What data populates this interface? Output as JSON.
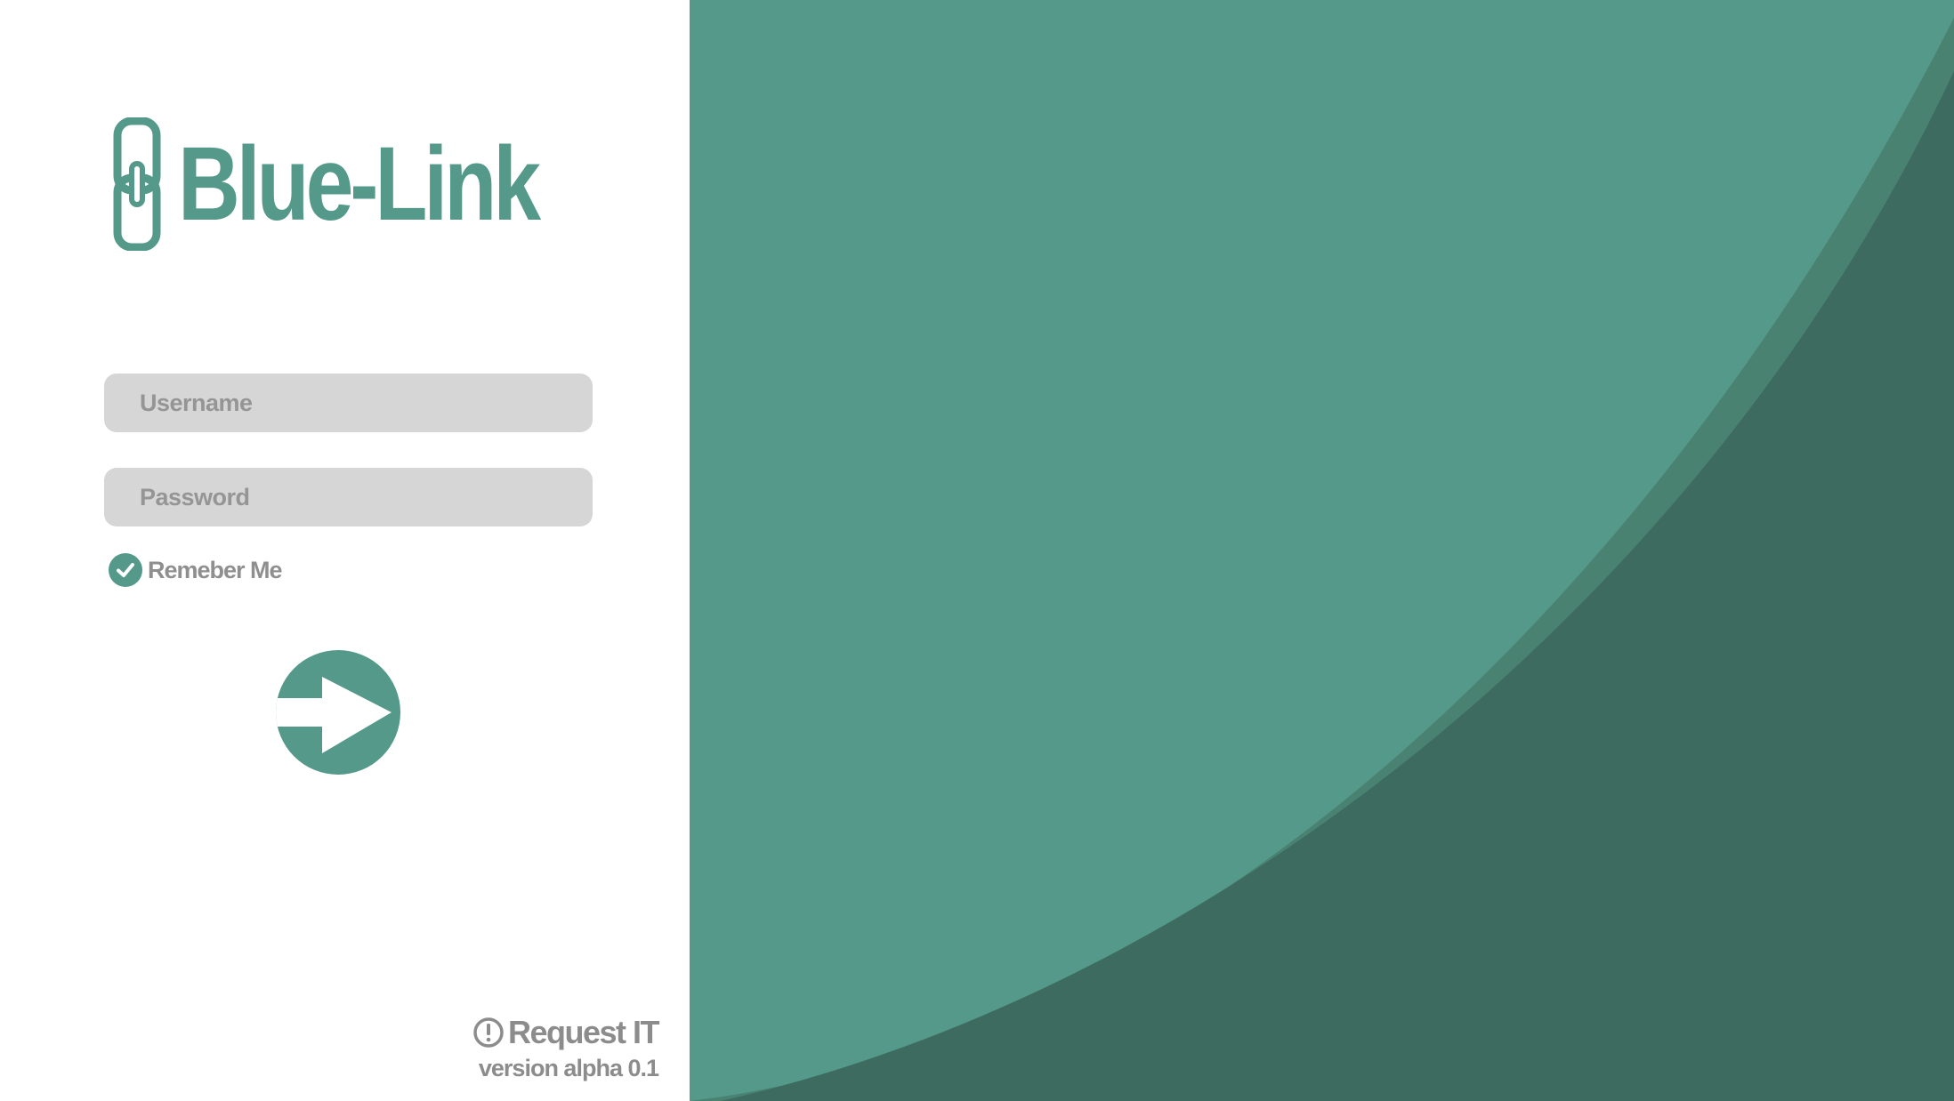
{
  "app": {
    "name": "Blue-Link"
  },
  "login": {
    "username_placeholder": "Username",
    "password_placeholder": "Password",
    "remember_label": "Remeber Me",
    "remember_checked": true
  },
  "footer": {
    "request_label": "Request IT",
    "version": "version alpha 0.1"
  },
  "icons": {
    "logo": "chain-link-icon",
    "remember": "checkmark-icon",
    "submit": "arrow-right-icon",
    "request": "exclamation-circle-icon"
  },
  "colors": {
    "brand": "#54998a",
    "brand_mid": "#4a8272",
    "brand_dark": "#3d6b5f",
    "field_bg": "#d6d6d6",
    "muted_text": "#8c8c8c"
  }
}
